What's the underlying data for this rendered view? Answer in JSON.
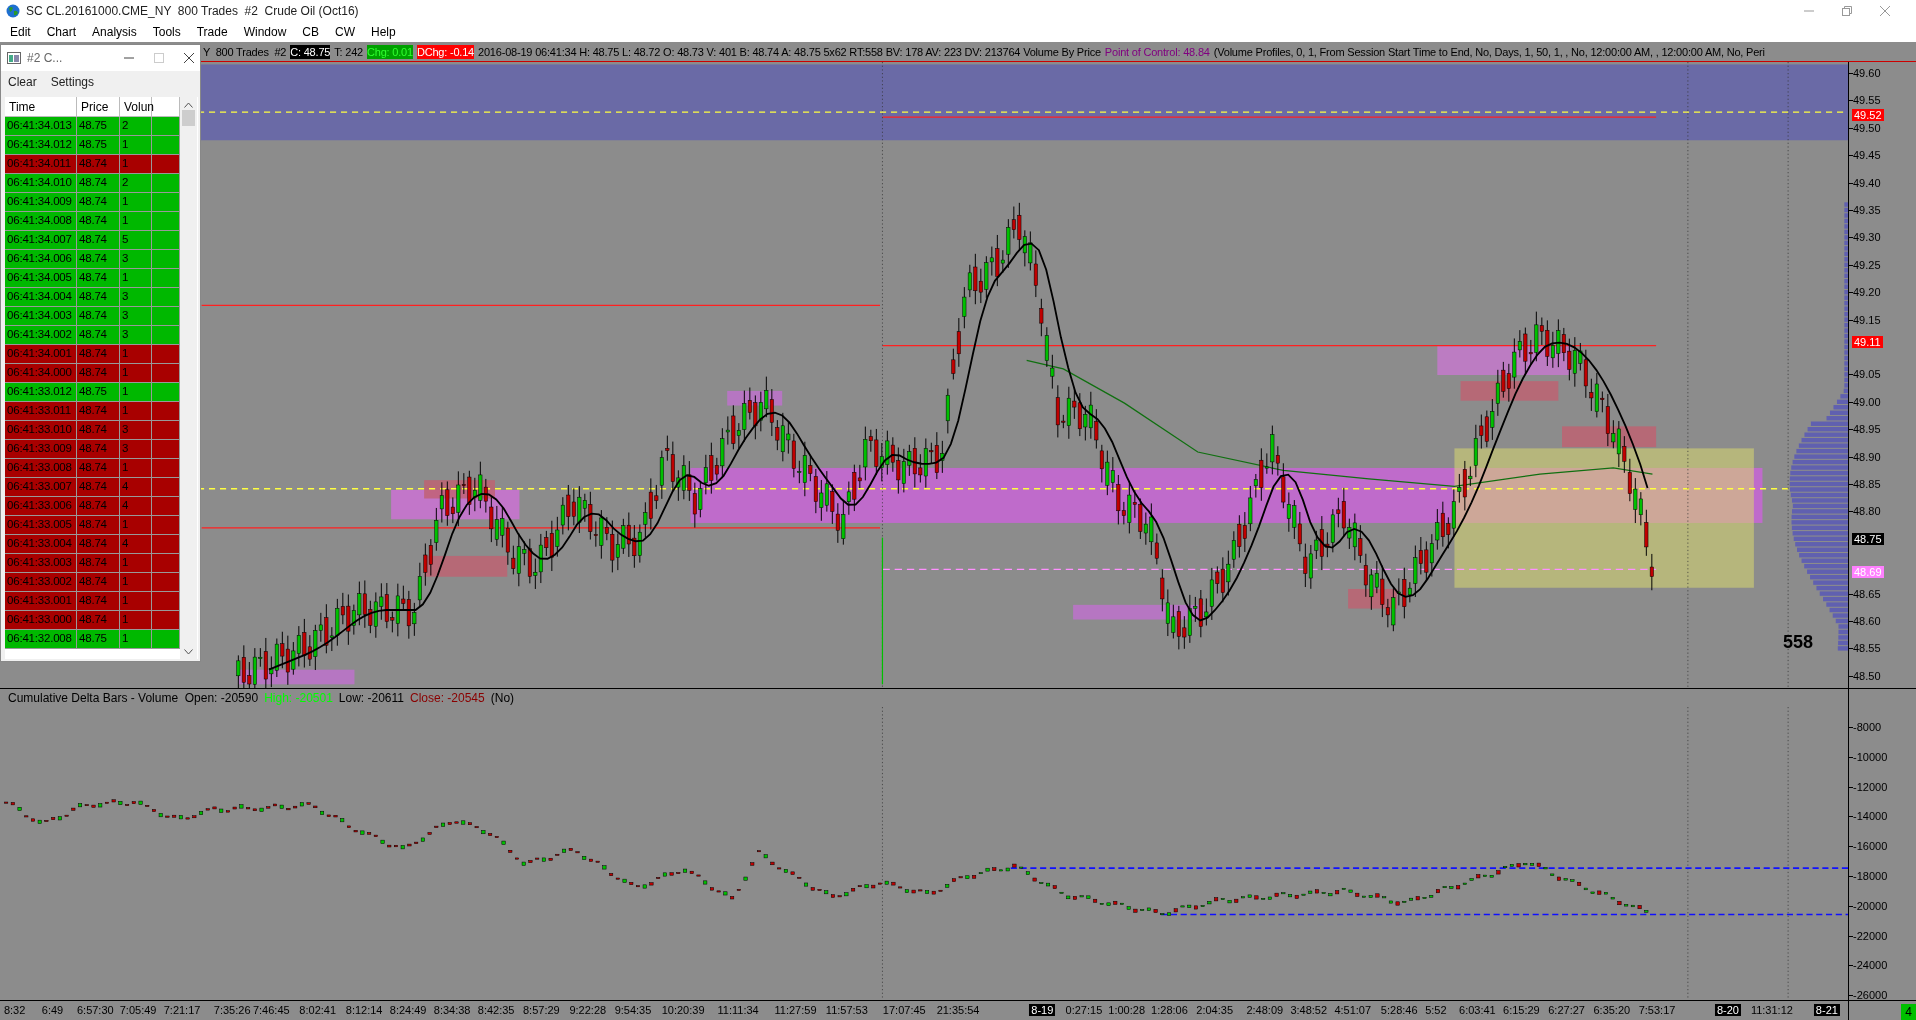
{
  "window": {
    "title": "SC CL.20161000.CME_NY  800 Trades  #2  Crude Oil (Oct16)"
  },
  "menu": [
    "Edit",
    "Chart",
    "Analysis",
    "Tools",
    "Trade",
    "Window",
    "CB",
    "CW",
    "Help"
  ],
  "chart_info": {
    "segments": [
      {
        "text": "Y  800 Trades  #2",
        "kind": "plain"
      },
      {
        "text": "C: 48.75",
        "kind": "dark"
      },
      {
        "text": "T: 242",
        "kind": "plain"
      },
      {
        "text": "Chg: 0.01",
        "kind": "up"
      },
      {
        "text": "DChg: -0.14",
        "kind": "down"
      },
      {
        "text": "2016-08-19 06:41:34 H: 48.75 L: 48.72 O: 48.73 V: 401 B: 48.74 A: 48.75 5x62 RT:558 BV: 178 AV: 223 DV: 213764 Volume By Price",
        "kind": "plain"
      },
      {
        "text": "Point of Control: 48.84",
        "kind": "poc"
      },
      {
        "text": "(Volume Profiles, 0, 1, From Session Start Time to End, No, Days, 1, 50, 1, , No, 12:00:00 AM, , 12:00:00 AM, No, Peri",
        "kind": "plain"
      }
    ]
  },
  "price_axis": {
    "ticks": [
      "49.60",
      "49.55",
      "49.50",
      "49.45",
      "49.40",
      "49.35",
      "49.30",
      "49.25",
      "49.20",
      "49.15",
      "49.05",
      "49.00",
      "48.95",
      "48.90",
      "48.85",
      "48.80",
      "48.65",
      "48.60",
      "48.55",
      "48.50"
    ],
    "markers": [
      {
        "text": "49.52",
        "color": "#ff0000"
      },
      {
        "text": "49.11",
        "color": "#ff0000"
      },
      {
        "text": "48.75",
        "color": "#000000"
      },
      {
        "text": "48.69",
        "color": "#ff80ff"
      }
    ]
  },
  "bar_count": "558",
  "indicator": {
    "segments": [
      {
        "text": "Cumulative Delta Bars - Volume  Open: -20590",
        "kind": "plain"
      },
      {
        "text": "High: -20501",
        "kind": "up"
      },
      {
        "text": "Low: -20611",
        "kind": "plain"
      },
      {
        "text": "Close: -20545",
        "kind": "down"
      },
      {
        "text": "(No)",
        "kind": "plain"
      }
    ]
  },
  "delta_axis": {
    "ticks": [
      "-8000",
      "-10000",
      "-12000",
      "-14000",
      "-16000",
      "-18000",
      "-20000",
      "-22000",
      "-24000",
      "-26000"
    ]
  },
  "time_axis": {
    "labels": [
      {
        "text": "8:32",
        "kind": "time"
      },
      {
        "text": "6:49",
        "kind": "time"
      },
      {
        "text": "6:57:30",
        "kind": "time"
      },
      {
        "text": "7:05:49",
        "kind": "time"
      },
      {
        "text": "7:21:17",
        "kind": "time"
      },
      {
        "text": "7:35:26",
        "kind": "time"
      },
      {
        "text": "7:46:45",
        "kind": "time"
      },
      {
        "text": "8:02:41",
        "kind": "time"
      },
      {
        "text": "8:12:14",
        "kind": "time"
      },
      {
        "text": "8:24:49",
        "kind": "time"
      },
      {
        "text": "8:34:38",
        "kind": "time"
      },
      {
        "text": "8:42:35",
        "kind": "time"
      },
      {
        "text": "8:57:29",
        "kind": "time"
      },
      {
        "text": "9:22:28",
        "kind": "time"
      },
      {
        "text": "9:54:35",
        "kind": "time"
      },
      {
        "text": "10:20:39",
        "kind": "time"
      },
      {
        "text": "11:11:34",
        "kind": "time"
      },
      {
        "text": "11:27:59",
        "kind": "time"
      },
      {
        "text": "11:57:53",
        "kind": "time"
      },
      {
        "text": "17:07:45",
        "kind": "time"
      },
      {
        "text": "21:35:54",
        "kind": "time"
      },
      {
        "text": "8-19",
        "kind": "date"
      },
      {
        "text": "0:27:15",
        "kind": "time"
      },
      {
        "text": "1:00:28",
        "kind": "time"
      },
      {
        "text": "1:28:06",
        "kind": "time"
      },
      {
        "text": "2:04:35",
        "kind": "time"
      },
      {
        "text": "2:48:09",
        "kind": "time"
      },
      {
        "text": "3:48:52",
        "kind": "time"
      },
      {
        "text": "4:51:07",
        "kind": "time"
      },
      {
        "text": "5:28:46",
        "kind": "time"
      },
      {
        "text": "5:52",
        "kind": "time"
      },
      {
        "text": "6:03:41",
        "kind": "time"
      },
      {
        "text": "6:15:29",
        "kind": "time"
      },
      {
        "text": "6:27:27",
        "kind": "time"
      },
      {
        "text": "6:35:20",
        "kind": "time"
      },
      {
        "text": "7:53:17",
        "kind": "time"
      },
      {
        "text": "8-20",
        "kind": "date"
      },
      {
        "text": "11:31:12",
        "kind": "time"
      },
      {
        "text": "8-21",
        "kind": "date"
      }
    ]
  },
  "corner_badge": "4",
  "time_and_sales": {
    "title": "#2 C...",
    "toolbar": [
      "Clear",
      "Settings"
    ],
    "columns": [
      "Time",
      "Price",
      "Volun"
    ],
    "rows": [
      {
        "time": "06:41:34.013",
        "price": "48.75",
        "volume": "2",
        "color": "#00b800"
      },
      {
        "time": "06:41:34.012",
        "price": "48.75",
        "volume": "1",
        "color": "#00b800"
      },
      {
        "time": "06:41:34.011",
        "price": "48.74",
        "volume": "1",
        "color": "#a80000"
      },
      {
        "time": "06:41:34.010",
        "price": "48.74",
        "volume": "2",
        "color": "#00b800"
      },
      {
        "time": "06:41:34.009",
        "price": "48.74",
        "volume": "1",
        "color": "#00b800"
      },
      {
        "time": "06:41:34.008",
        "price": "48.74",
        "volume": "1",
        "color": "#00b800"
      },
      {
        "time": "06:41:34.007",
        "price": "48.74",
        "volume": "5",
        "color": "#00b800"
      },
      {
        "time": "06:41:34.006",
        "price": "48.74",
        "volume": "3",
        "color": "#00b800"
      },
      {
        "time": "06:41:34.005",
        "price": "48.74",
        "volume": "1",
        "color": "#00b800"
      },
      {
        "time": "06:41:34.004",
        "price": "48.74",
        "volume": "3",
        "color": "#00b800"
      },
      {
        "time": "06:41:34.003",
        "price": "48.74",
        "volume": "3",
        "color": "#00b800"
      },
      {
        "time": "06:41:34.002",
        "price": "48.74",
        "volume": "3",
        "color": "#00b800"
      },
      {
        "time": "06:41:34.001",
        "price": "48.74",
        "volume": "1",
        "color": "#a80000"
      },
      {
        "time": "06:41:34.000",
        "price": "48.74",
        "volume": "1",
        "color": "#a80000"
      },
      {
        "time": "06:41:33.012",
        "price": "48.75",
        "volume": "1",
        "color": "#00b800"
      },
      {
        "time": "06:41:33.011",
        "price": "48.74",
        "volume": "1",
        "color": "#a80000"
      },
      {
        "time": "06:41:33.010",
        "price": "48.74",
        "volume": "3",
        "color": "#a80000"
      },
      {
        "time": "06:41:33.009",
        "price": "48.74",
        "volume": "3",
        "color": "#a80000"
      },
      {
        "time": "06:41:33.008",
        "price": "48.74",
        "volume": "1",
        "color": "#a80000"
      },
      {
        "time": "06:41:33.007",
        "price": "48.74",
        "volume": "4",
        "color": "#a80000"
      },
      {
        "time": "06:41:33.006",
        "price": "48.74",
        "volume": "4",
        "color": "#a80000"
      },
      {
        "time": "06:41:33.005",
        "price": "48.74",
        "volume": "1",
        "color": "#a80000"
      },
      {
        "time": "06:41:33.004",
        "price": "48.74",
        "volume": "4",
        "color": "#a80000"
      },
      {
        "time": "06:41:33.003",
        "price": "48.74",
        "volume": "1",
        "color": "#a80000"
      },
      {
        "time": "06:41:33.002",
        "price": "48.74",
        "volume": "1",
        "color": "#a80000"
      },
      {
        "time": "06:41:33.001",
        "price": "48.74",
        "volume": "1",
        "color": "#a80000"
      },
      {
        "time": "06:41:33.000",
        "price": "48.74",
        "volume": "1",
        "color": "#a80000"
      },
      {
        "time": "06:41:32.008",
        "price": "48.75",
        "volume": "1",
        "color": "#00b800"
      }
    ]
  }
}
